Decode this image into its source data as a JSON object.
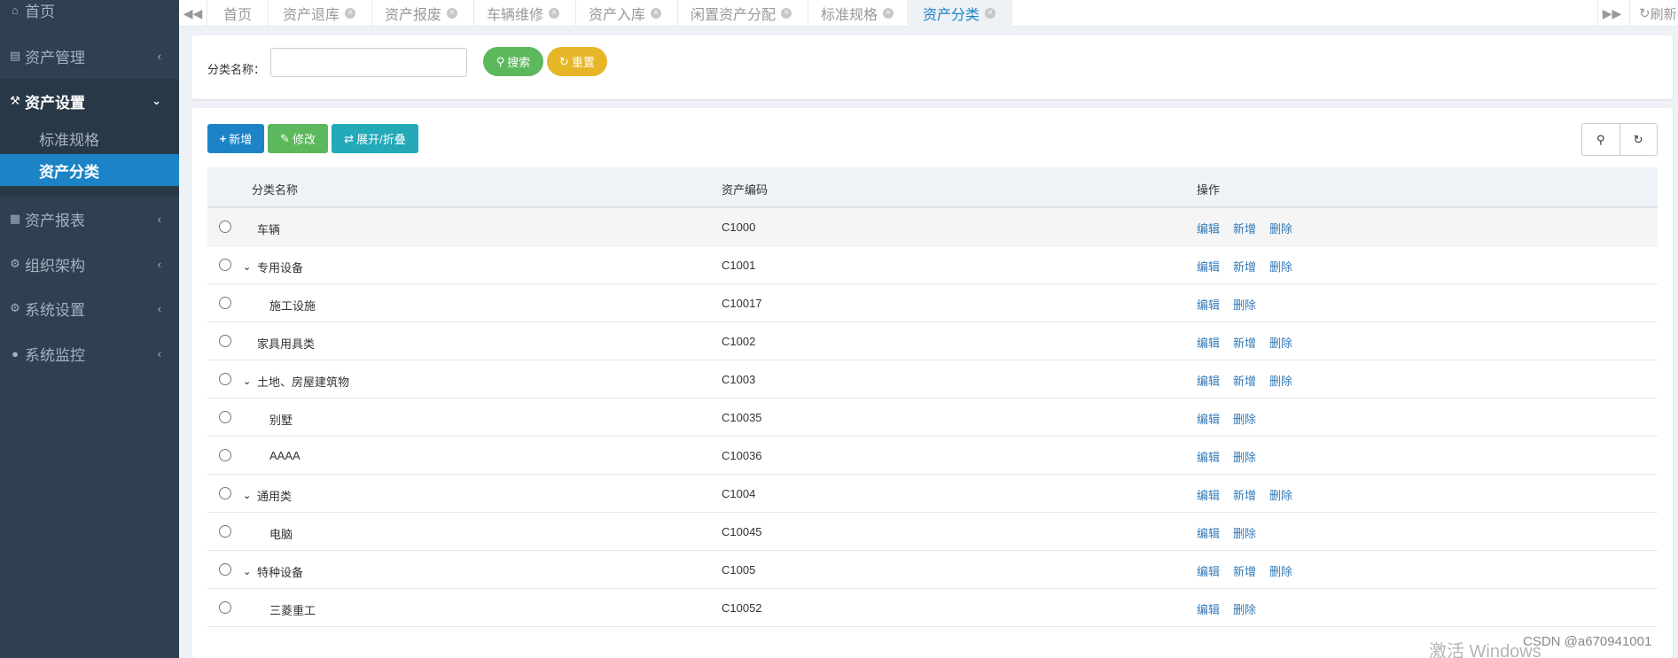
{
  "sidebar": {
    "home": "首页",
    "asset_mgmt": "资产管理",
    "asset_settings": "资产设置",
    "sub_standard": "标准规格",
    "sub_category": "资产分类",
    "asset_reports": "资产报表",
    "org": "组织架构",
    "sys_settings": "系统设置",
    "sys_monitor": "系统监控"
  },
  "tabs": {
    "items": [
      "首页",
      "资产退库",
      "资产报废",
      "车辆维修",
      "资产入库",
      "闲置资产分配",
      "标准规格",
      "资产分类"
    ],
    "refresh": "刷新"
  },
  "search": {
    "label": "分类名称：",
    "value": "",
    "search_btn": "搜索",
    "reset_btn": "重置"
  },
  "toolbar": {
    "add": "新增",
    "edit": "修改",
    "toggle": "展开/折叠"
  },
  "table": {
    "headers": [
      "分类名称",
      "资产编码",
      "操作"
    ],
    "rows": [
      {
        "name": "车辆",
        "code": "C1000",
        "ops": [
          "编辑",
          "新增",
          "删除"
        ]
      },
      {
        "name": "专用设备",
        "code": "C1001",
        "ops": [
          "编辑",
          "新增",
          "删除"
        ]
      },
      {
        "name": "施工设施",
        "code": "C10017",
        "ops": [
          "编辑",
          "删除"
        ]
      },
      {
        "name": "家具用具类",
        "code": "C1002",
        "ops": [
          "编辑",
          "新增",
          "删除"
        ]
      },
      {
        "name": "土地、房屋建筑物",
        "code": "C1003",
        "ops": [
          "编辑",
          "新增",
          "删除"
        ]
      },
      {
        "name": "别墅",
        "code": "C10035",
        "ops": [
          "编辑",
          "删除"
        ]
      },
      {
        "name": "AAAA",
        "code": "C10036",
        "ops": [
          "编辑",
          "删除"
        ]
      },
      {
        "name": "通用类",
        "code": "C1004",
        "ops": [
          "编辑",
          "新增",
          "删除"
        ]
      },
      {
        "name": "电脑",
        "code": "C10045",
        "ops": [
          "编辑",
          "删除"
        ]
      },
      {
        "name": "特种设备",
        "code": "C1005",
        "ops": [
          "编辑",
          "新增",
          "删除"
        ]
      },
      {
        "name": "三菱重工",
        "code": "C10052",
        "ops": [
          "编辑",
          "删除"
        ]
      }
    ]
  },
  "watermark": "激活 Windows",
  "csdn": "CSDN @a670941001",
  "colors": {
    "sidebar_bg": "#2f4050",
    "active_blue": "#1c84c6",
    "green": "#5cb85c",
    "yellow": "#e6b628",
    "cyan": "#23a9b7",
    "link": "#337ab7"
  }
}
